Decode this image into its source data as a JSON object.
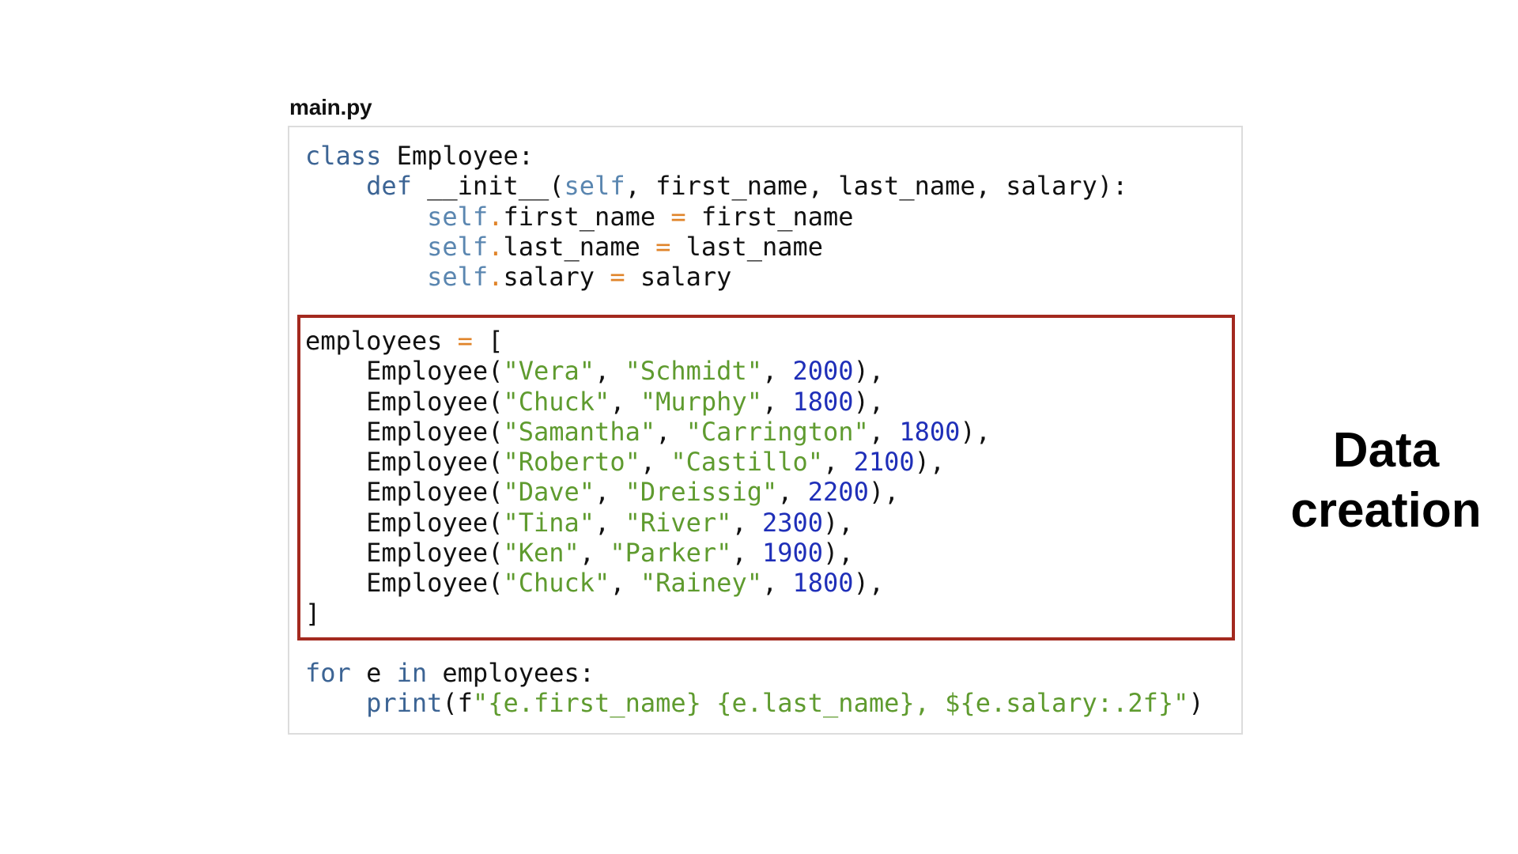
{
  "file": {
    "name": "main.py"
  },
  "side_label": {
    "line1": "Data",
    "line2": "creation"
  },
  "class_block": {
    "l1_kw": "class",
    "l1_rest": " Employee:",
    "l2_indent": "    ",
    "l2_kw": "def",
    "l2_a": " __init__(",
    "l2_self": "self",
    "l2_b": ", first_name, last_name, salary):",
    "attrs": [
      {
        "self": "self",
        "dot": ".",
        "name": "first_name ",
        "op": "=",
        "value": " first_name"
      },
      {
        "self": "self",
        "dot": ".",
        "name": "last_name ",
        "op": "=",
        "value": " last_name"
      },
      {
        "self": "self",
        "dot": ".",
        "name": "salary ",
        "op": "=",
        "value": " salary"
      }
    ]
  },
  "data_block": {
    "open_var": "employees ",
    "open_op": "=",
    "open_bracket": " [",
    "call_name": "Employee(",
    "rows": [
      {
        "first": "\"Vera\"",
        "last": "\"Schmidt\"",
        "salary": "2000"
      },
      {
        "first": "\"Chuck\"",
        "last": "\"Murphy\"",
        "salary": "1800"
      },
      {
        "first": "\"Samantha\"",
        "last": "\"Carrington\"",
        "salary": "1800"
      },
      {
        "first": "\"Roberto\"",
        "last": "\"Castillo\"",
        "salary": "2100"
      },
      {
        "first": "\"Dave\"",
        "last": "\"Dreissig\"",
        "salary": "2200"
      },
      {
        "first": "\"Tina\"",
        "last": "\"River\"",
        "salary": "2300"
      },
      {
        "first": "\"Ken\"",
        "last": "\"Parker\"",
        "salary": "1900"
      },
      {
        "first": "\"Chuck\"",
        "last": "\"Rainey\"",
        "salary": "1800"
      }
    ],
    "sep": ", ",
    "close_call": "),",
    "close_bracket": "]"
  },
  "loop_block": {
    "for_kw": "for",
    "var": " e ",
    "in_kw": "in",
    "iter": " employees:",
    "print_kw": "print",
    "print_open": "(f",
    "fstring": "\"{e.first_name} {e.last_name}, ${e.salary:.2f}\"",
    "print_close": ")"
  },
  "colors": {
    "keyword": "#3c6494",
    "self": "#5a86b0",
    "operator": "#e0842a",
    "string": "#5f9b2f",
    "number": "#1f2fb8",
    "highlight_border": "#a3291f"
  }
}
